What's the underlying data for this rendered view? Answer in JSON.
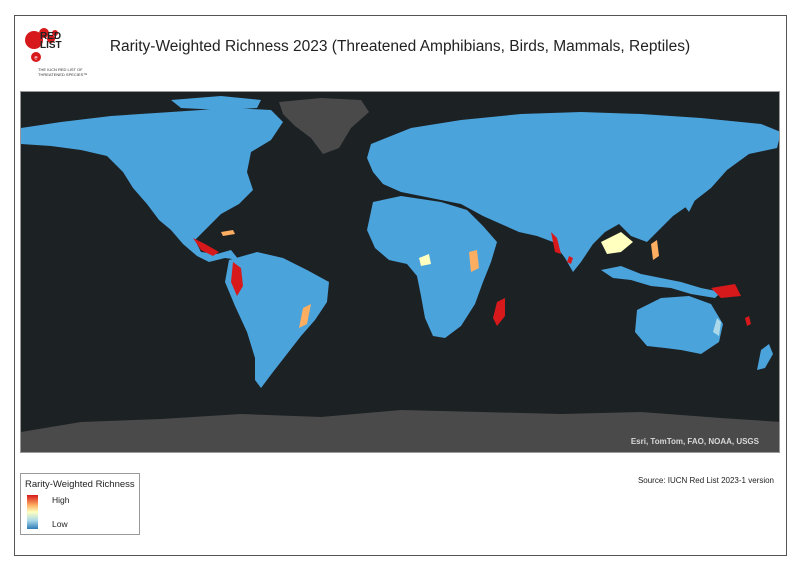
{
  "header": {
    "title": "Rarity-Weighted Richness 2023 (Threatened Amphibians, Birds, Mammals, Reptiles)",
    "logo_text": "RED\nLIST",
    "logo_subtext": "THE IUCN RED LIST OF THREATENED SPECIES™"
  },
  "map": {
    "attribution": "Esri, TomTom, FAO, NOAA, USGS",
    "colors": {
      "ocean": "#1c2124",
      "land_low": "#4ba3dc",
      "land_medium": "#abd9e9",
      "land_elevated": "#ffffbf",
      "land_high": "#d7191c",
      "no_data": "#4a4a4a"
    }
  },
  "legend": {
    "title": "Rarity-Weighted Richness",
    "high_label": "High",
    "low_label": "Low"
  },
  "source": "Source: IUCN Red List 2023-1 version"
}
